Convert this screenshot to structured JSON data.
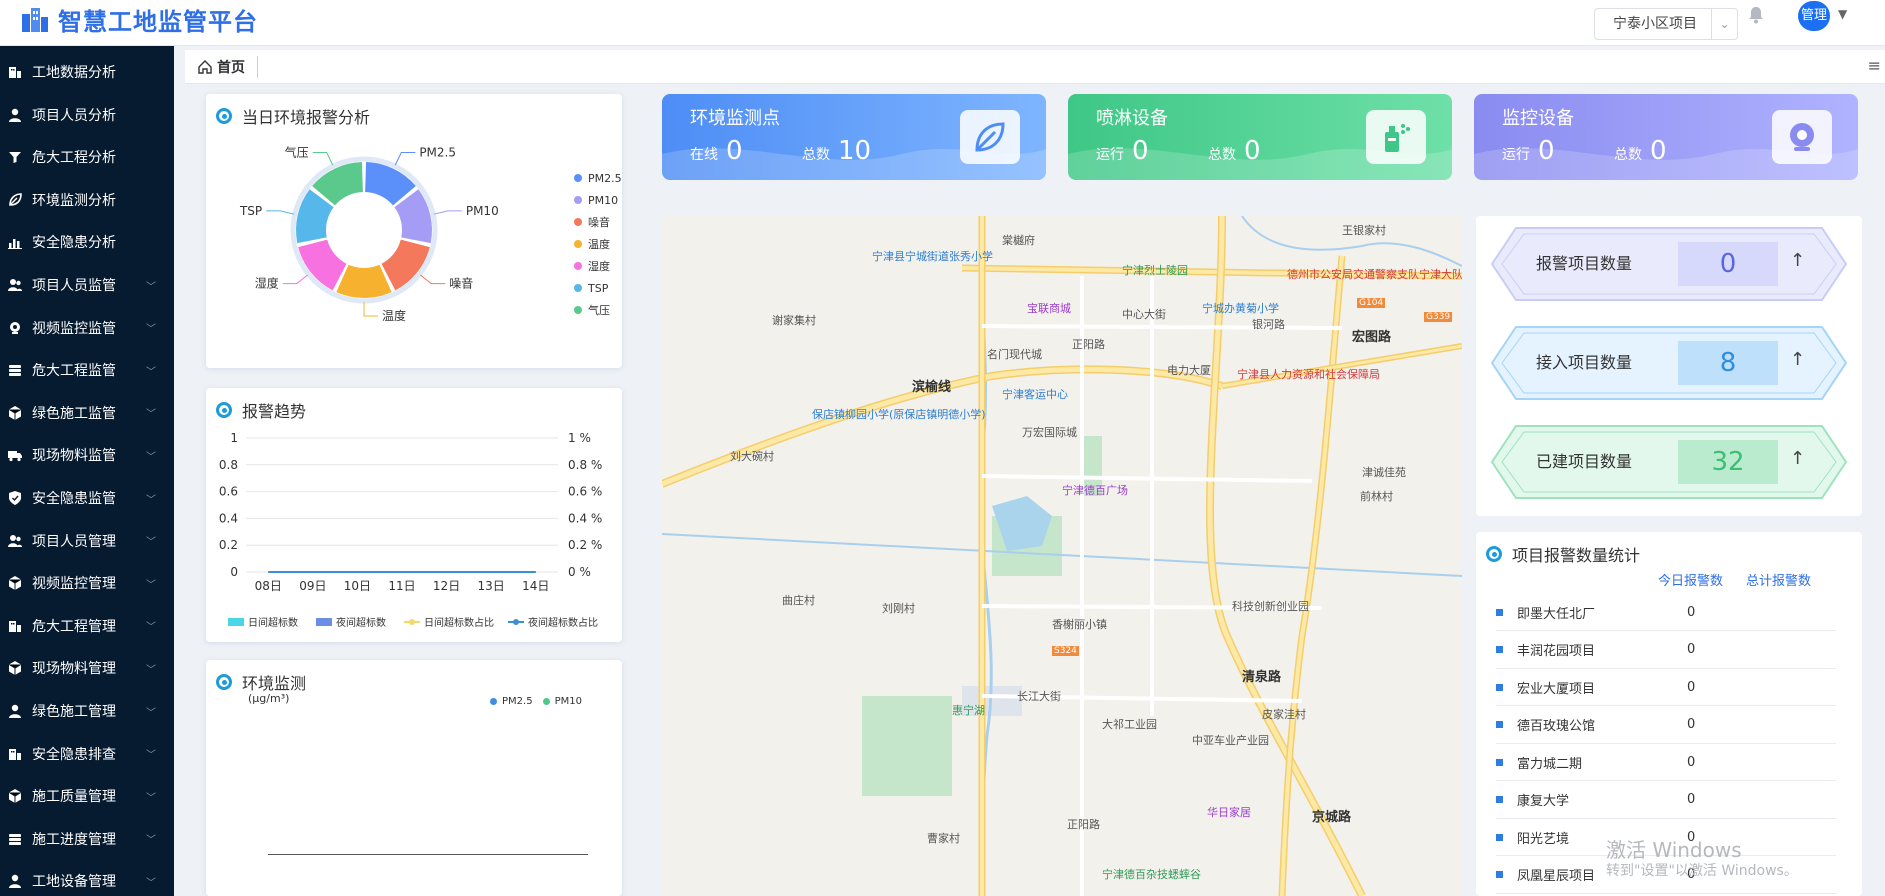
{
  "header": {
    "title": "智慧工地监管平台",
    "project_select": "宁泰小区项目",
    "avatar_text": "管理"
  },
  "sidebar": {
    "items": [
      {
        "label": "工地数据分析",
        "icon": "building-icon",
        "expandable": false
      },
      {
        "label": "项目人员分析",
        "icon": "person-icon",
        "expandable": false
      },
      {
        "label": "危大工程分析",
        "icon": "filter-icon",
        "expandable": false
      },
      {
        "label": "环境监测分析",
        "icon": "leaf-icon",
        "expandable": false
      },
      {
        "label": "安全隐患分析",
        "icon": "bar-chart-icon",
        "expandable": false
      },
      {
        "label": "项目人员监管",
        "icon": "people-icon",
        "expandable": true
      },
      {
        "label": "视频监控监管",
        "icon": "camera-icon",
        "expandable": true
      },
      {
        "label": "危大工程监管",
        "icon": "stack-icon",
        "expandable": true
      },
      {
        "label": "绿色施工监管",
        "icon": "cube-icon",
        "expandable": true
      },
      {
        "label": "现场物料监管",
        "icon": "truck-icon",
        "expandable": true
      },
      {
        "label": "安全隐患监管",
        "icon": "shield-icon",
        "expandable": true
      },
      {
        "label": "项目人员管理",
        "icon": "people-icon",
        "expandable": true
      },
      {
        "label": "视频监控管理",
        "icon": "cube-icon",
        "expandable": true
      },
      {
        "label": "危大工程管理",
        "icon": "building-icon",
        "expandable": true
      },
      {
        "label": "现场物料管理",
        "icon": "cube-icon",
        "expandable": true
      },
      {
        "label": "绿色施工管理",
        "icon": "person-icon",
        "expandable": true
      },
      {
        "label": "安全隐患排查",
        "icon": "building-icon",
        "expandable": true
      },
      {
        "label": "施工质量管理",
        "icon": "cube-icon",
        "expandable": true
      },
      {
        "label": "施工进度管理",
        "icon": "stack-icon",
        "expandable": true
      },
      {
        "label": "工地设备管理",
        "icon": "person-icon",
        "expandable": true
      }
    ]
  },
  "tabs": {
    "home": "首页"
  },
  "env_alarm": {
    "title": "当日环境报警分析",
    "chart_data": {
      "type": "pie",
      "categories": [
        "PM2.5",
        "PM10",
        "噪音",
        "温度",
        "湿度",
        "TSP",
        "气压"
      ],
      "values": [
        1,
        1,
        1,
        1,
        1,
        1,
        1
      ],
      "colors": [
        "#5b8ff9",
        "#a59cf5",
        "#f4795c",
        "#f6b12e",
        "#f772e0",
        "#56b8ea",
        "#5ac98b"
      ],
      "legend": [
        "PM2.5",
        "PM10",
        "噪音",
        "温度",
        "湿度",
        "TSP",
        "气压"
      ],
      "slice_labels": [
        "PM2.5",
        "PM10",
        "噪音",
        "温度",
        "湿度",
        "TSP",
        "气压"
      ],
      "legend_position": "right"
    }
  },
  "alarm_trend": {
    "title": "报警趋势",
    "chart_data": {
      "type": "line",
      "categories": [
        "08日",
        "09日",
        "10日",
        "11日",
        "12日",
        "13日",
        "14日"
      ],
      "y_left_ticks": [
        "1",
        "0.8",
        "0.6",
        "0.4",
        "0.2",
        "0"
      ],
      "y_right_ticks": [
        "1 %",
        "0.8 %",
        "0.6 %",
        "0.4 %",
        "0.2 %",
        "0 %"
      ],
      "ylim": [
        0,
        1
      ],
      "series": [
        {
          "name": "日间超标数",
          "values": [
            0,
            0,
            0,
            0,
            0,
            0,
            0
          ],
          "color": "#4bd6e3"
        },
        {
          "name": "夜间超标数",
          "values": [
            0,
            0,
            0,
            0,
            0,
            0,
            0
          ],
          "color": "#6a8ee8"
        },
        {
          "name": "日间超标数占比",
          "values": [
            0,
            0,
            0,
            0,
            0,
            0,
            0
          ],
          "color": "#f5d86b"
        },
        {
          "name": "夜间超标数占比",
          "values": [
            0,
            0,
            0,
            0,
            0,
            0,
            0
          ],
          "color": "#3a8fd6"
        }
      ],
      "legend_position": "bottom"
    }
  },
  "env_monitor": {
    "title": "环境监测",
    "unit": "(μg/m³)",
    "chart_data": {
      "type": "line",
      "series": [
        {
          "name": "PM2.5",
          "values": [],
          "color": "#3f8ee0"
        },
        {
          "name": "PM10",
          "values": [],
          "color": "#4cc98c"
        }
      ],
      "legend_position": "top-right"
    }
  },
  "stat_cards": [
    {
      "title": "环境监测点",
      "label1": "在线",
      "value1": "0",
      "label2": "总数",
      "value2": "10",
      "icon": "leaf-icon",
      "color1": "#4d8df5",
      "color2": "#7fb5ff"
    },
    {
      "title": "喷淋设备",
      "label1": "运行",
      "value1": "0",
      "label2": "总数",
      "value2": "0",
      "icon": "sprayer-icon",
      "color1": "#3ec786",
      "color2": "#6ee0a8"
    },
    {
      "title": "监控设备",
      "label1": "运行",
      "value1": "0",
      "label2": "总数",
      "value2": "0",
      "icon": "webcam-icon",
      "color1": "#8a8bf0",
      "color2": "#b0b3ff"
    }
  ],
  "map": {
    "labels": [
      "王银家村",
      "棠樾府",
      "宁津县宁城街道张秀小学",
      "宁津烈士陵园",
      "德州市公安局交通警察支队宁津大队",
      "谢家集村",
      "宝联商城",
      "中心大街",
      "宁城办黄菊小学",
      "银河路",
      "宏图路",
      "名门现代城",
      "正阳路",
      "电力大厦",
      "宁津县人力资源和社会保障局",
      "滨榆线",
      "宁津客运中心",
      "保店镇柳园小学(原保店镇明德小学)",
      "万宏国际城",
      "刘大碗村",
      "津诚佳苑",
      "宁津德百广场",
      "前林村",
      "曲庄村",
      "刘刚村",
      "科技创新创业园",
      "香榭丽小镇",
      "清泉路",
      "惠宁湖",
      "长江大街",
      "皮家洼村",
      "大祁工业园",
      "中亚车业产业园",
      "正阳路",
      "华日家居",
      "京城路",
      "曹家村",
      "宁津德百杂技蟋蟀谷",
      "G104",
      "G339",
      "S324"
    ]
  },
  "project_counts": [
    {
      "label": "报警项目数量",
      "value": "0",
      "color": "#5b67e0",
      "arrow": "↑"
    },
    {
      "label": "接入项目数量",
      "value": "8",
      "color": "#2f8de0",
      "arrow": "↑"
    },
    {
      "label": "已建项目数量",
      "value": "32",
      "color": "#3bbf74",
      "arrow": "↑"
    }
  ],
  "alarm_stats": {
    "title": "项目报警数量统计",
    "col_today": "今日报警数",
    "col_total": "总计报警数",
    "rows": [
      {
        "name": "即墨大任北厂",
        "today": "0"
      },
      {
        "name": "丰润花园项目",
        "today": "0"
      },
      {
        "name": "宏业大厦项目",
        "today": "0"
      },
      {
        "name": "德百玫瑰公馆",
        "today": "0"
      },
      {
        "name": "富力城二期",
        "today": "0"
      },
      {
        "name": "康复大学",
        "today": "0"
      },
      {
        "name": "阳光艺境",
        "today": "0"
      },
      {
        "name": "凤凰星辰项目",
        "today": "0"
      }
    ]
  },
  "watermark": {
    "line1": "激活 Windows",
    "line2": "转到\"设置\"以激活 Windows。"
  }
}
